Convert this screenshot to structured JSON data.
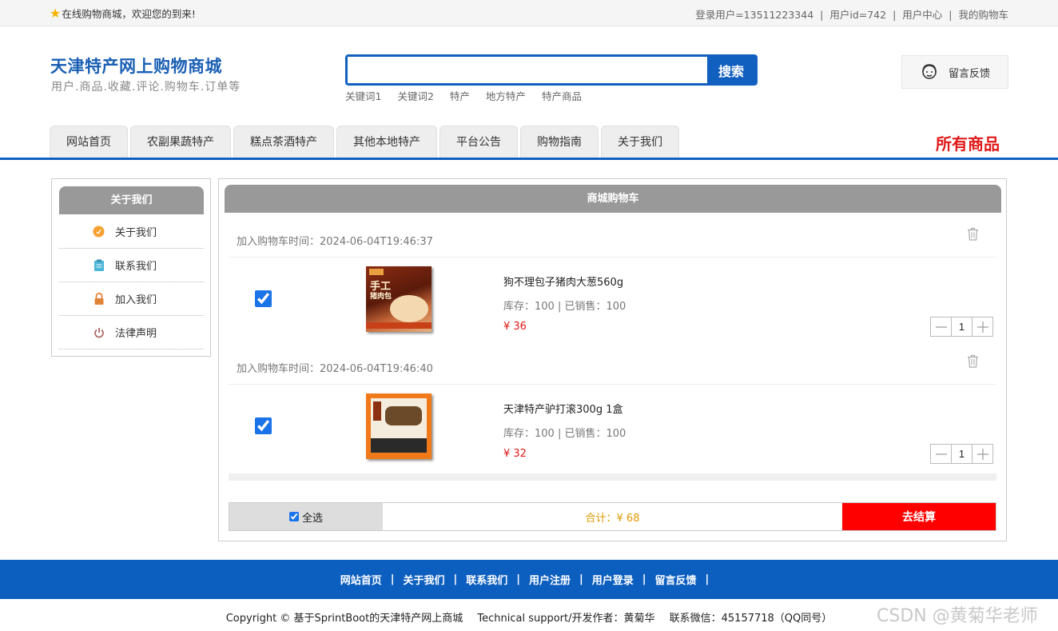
{
  "topbar": {
    "welcome": "在线购物商城，欢迎您的到来!",
    "login_user": "登录用户=13511223344",
    "user_id": "用户id=742",
    "user_center": "用户中心",
    "my_cart": "我的购物车",
    "sep": "|"
  },
  "header": {
    "title": "天津特产网上购物商城",
    "subtitle": "用户.商品.收藏.评论.购物车.订单等",
    "search_value": "",
    "search_button": "搜索",
    "hotwords": [
      "关键词1",
      "关键词2",
      "特产",
      "地方特产",
      "特产商品"
    ],
    "feedback": "留言反馈"
  },
  "nav": {
    "tabs": [
      "网站首页",
      "农副果蔬特产",
      "糕点茶酒特产",
      "其他本地特产",
      "平台公告",
      "购物指南",
      "关于我们"
    ],
    "all_goods": "所有商品"
  },
  "sidebar": {
    "title": "关于我们",
    "items": [
      {
        "label": "关于我们",
        "icon": "info-circle-icon"
      },
      {
        "label": "联系我们",
        "icon": "clipboard-icon"
      },
      {
        "label": "加入我们",
        "icon": "lock-icon"
      },
      {
        "label": "法律声明",
        "icon": "power-icon"
      }
    ]
  },
  "cart": {
    "title": "商城购物车",
    "items": [
      {
        "added": "加入购物车时间：2024-06-04T19:46:37",
        "name": "狗不理包子猪肉大葱560g",
        "stock": "库存：100 | 已销售：100",
        "price": "¥ 36",
        "qty": "1",
        "checked": true,
        "thumb_text": "手工",
        "thumb_text2": "猪肉包"
      },
      {
        "added": "加入购物车时间：2024-06-04T19:46:40",
        "name": "天津特产驴打滚300g 1盒",
        "stock": "库存：100 | 已销售：100",
        "price": "¥ 32",
        "qty": "1",
        "checked": true
      }
    ],
    "select_all": "全选",
    "total": "合计：¥ 68",
    "checkout": "去结算"
  },
  "footer": {
    "links": [
      "网站首页",
      "关于我们",
      "联系我们",
      "用户注册",
      "用户登录",
      "留言反馈"
    ],
    "sep": "|",
    "copyright": "Copyright © 基于SprintBoot的天津特产网上商城",
    "support": "Technical support/开发作者：黄菊华",
    "contact": "联系微信：45157718（QQ同号）"
  },
  "watermark": "CSDN @黄菊华老师",
  "colors": {
    "brand_blue": "#1160c0",
    "price_red": "#e01818",
    "checkout_red": "#ff0000",
    "total_orange": "#e09a00"
  }
}
